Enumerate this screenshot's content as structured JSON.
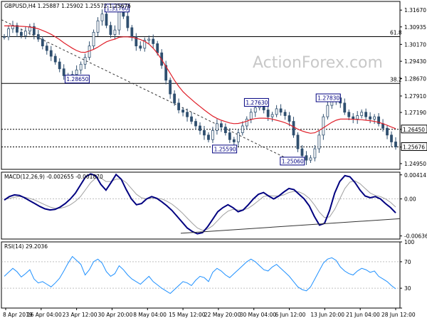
{
  "chart_data": [
    {
      "type": "candlestick",
      "panel": "price",
      "title": "GBPUSD,H4 1.25887 1.25902 1.25572 1.25676",
      "watermark": "ActionForex.com",
      "ylim": [
        1.247,
        1.3205
      ],
      "yticks": [
        "1.31670",
        "1.30935",
        "1.30170",
        "1.29430",
        "1.28670",
        "1.27910",
        "1.27190",
        "1.26450",
        "1.25676",
        "1.24950"
      ],
      "ytick_values": [
        1.3167,
        1.30935,
        1.3017,
        1.2943,
        1.2867,
        1.2791,
        1.2719,
        1.2645,
        1.25676,
        1.2495
      ],
      "hlines": [
        {
          "value": 1.3051,
          "label": "61.8",
          "color": "#000000",
          "style": "solid"
        },
        {
          "value": 1.2846,
          "label": "38.2",
          "color": "#000000",
          "style": "solid"
        },
        {
          "value": 1.2645,
          "label": "1.26450",
          "color": "#000000",
          "style": "dotted"
        },
        {
          "value": 1.2568,
          "label": "1.25676",
          "color": "#000000",
          "style": "dotted"
        }
      ],
      "annotations": [
        {
          "text": "1.31760",
          "x": 0.29,
          "y": 1.3176
        },
        {
          "text": "1.28650",
          "x": 0.19,
          "y": 1.2865
        },
        {
          "text": "1.27630",
          "x": 0.64,
          "y": 1.2763
        },
        {
          "text": "1.27830",
          "x": 0.82,
          "y": 1.2783
        },
        {
          "text": "1.25590",
          "x": 0.56,
          "y": 1.2559
        },
        {
          "text": "1.25060",
          "x": 0.73,
          "y": 1.2506
        }
      ],
      "series": [
        {
          "name": "Close",
          "values": [
            1.305,
            1.3085,
            1.31,
            1.307,
            1.3055,
            1.3075,
            1.3095,
            1.306,
            1.304,
            1.301,
            1.299,
            1.2965,
            1.294,
            1.291,
            1.288,
            1.287,
            1.2885,
            1.2905,
            1.293,
            1.296,
            1.301,
            1.307,
            1.312,
            1.315,
            1.31,
            1.306,
            1.308,
            1.3176,
            1.314,
            1.309,
            1.305,
            1.301,
            1.3,
            1.3035,
            1.304,
            1.302,
            1.298,
            1.2925,
            1.286,
            1.28,
            1.276,
            1.273,
            1.272,
            1.27,
            1.268,
            1.266,
            1.264,
            1.262,
            1.26,
            1.264,
            1.267,
            1.2655,
            1.263,
            1.26,
            1.259,
            1.263,
            1.266,
            1.269,
            1.272,
            1.274,
            1.275,
            1.273,
            1.27,
            1.271,
            1.2735,
            1.272,
            1.2705,
            1.268,
            1.262,
            1.256,
            1.253,
            1.251,
            1.252,
            1.256,
            1.262,
            1.27,
            1.275,
            1.277,
            1.2783,
            1.276,
            1.272,
            1.27,
            1.269,
            1.2705,
            1.272,
            1.27,
            1.269,
            1.27,
            1.267,
            1.265,
            1.262,
            1.259,
            1.2568
          ]
        },
        {
          "name": "MA",
          "values": [
            1.3098,
            1.3098,
            1.3098,
            1.3097,
            1.3096,
            1.3095,
            1.3093,
            1.309,
            1.3085,
            1.3078,
            1.307,
            1.3061,
            1.305,
            1.3038,
            1.3024,
            1.3012,
            1.3,
            1.299,
            1.2983,
            1.2982,
            1.2988,
            1.2995,
            1.3005,
            1.3017,
            1.3028,
            1.3035,
            1.304,
            1.3048,
            1.305,
            1.305,
            1.3048,
            1.3044,
            1.3038,
            1.303,
            1.3018,
            1.3,
            1.2978,
            1.295,
            1.292,
            1.289,
            1.286,
            1.2833,
            1.281,
            1.2792,
            1.2776,
            1.276,
            1.2745,
            1.273,
            1.2716,
            1.2703,
            1.2693,
            1.2685,
            1.2679,
            1.2673,
            1.267,
            1.2671,
            1.2675,
            1.2681,
            1.2688,
            1.2692,
            1.2694,
            1.2694,
            1.2693,
            1.269,
            1.2685,
            1.268,
            1.2674,
            1.2666,
            1.2656,
            1.2646,
            1.2638,
            1.2632,
            1.2628,
            1.263,
            1.264,
            1.2652,
            1.2664,
            1.2676,
            1.2685,
            1.269,
            1.269,
            1.269,
            1.2689,
            1.2688,
            1.2687,
            1.2685,
            1.2683,
            1.268,
            1.2676,
            1.267,
            1.2663,
            1.2655,
            1.2648
          ]
        }
      ],
      "trendline": {
        "from": {
          "x": 0.0,
          "y": 1.3125
        },
        "to": {
          "x": 0.73,
          "y": 1.2506
        }
      }
    },
    {
      "type": "line",
      "panel": "macd",
      "title": "MACD(12,26,9) -0.002655 -0.001870",
      "ylim": [
        -0.0069,
        0.0046
      ],
      "yticks": [
        "0.004141",
        "0.00",
        "-0.006365"
      ],
      "ytick_values": [
        0.004141,
        0.0,
        -0.006365
      ],
      "series": [
        {
          "name": "MACD",
          "values": [
            -0.0002,
            0.0004,
            0.0007,
            0.0006,
            0.0002,
            -0.0003,
            -0.0008,
            -0.0013,
            -0.0017,
            -0.0019,
            -0.0018,
            -0.0014,
            -0.0008,
            0.0,
            0.001,
            0.0024,
            0.0038,
            0.0043,
            0.004,
            0.0025,
            0.0015,
            0.0028,
            0.0042,
            0.0034,
            0.0016,
            0.0,
            -0.001,
            -0.0008,
            0.0,
            0.0004,
            0.0001,
            -0.0005,
            -0.0012,
            -0.002,
            -0.003,
            -0.004,
            -0.005,
            -0.0056,
            -0.006,
            -0.0058,
            -0.0048,
            -0.0035,
            -0.0022,
            -0.0015,
            -0.001,
            -0.0015,
            -0.0022,
            -0.0019,
            -0.001,
            0.0,
            0.0008,
            0.0011,
            0.0005,
            0.0,
            0.0005,
            0.0012,
            0.0018,
            0.0016,
            0.0008,
            0.0,
            -0.0012,
            -0.003,
            -0.0045,
            -0.0042,
            -0.002,
            0.001,
            0.003,
            0.004,
            0.0038,
            0.0028,
            0.0015,
            0.0005,
            0.0002,
            0.0004,
            0.0,
            -0.0008,
            -0.0015,
            -0.0024
          ]
        },
        {
          "name": "Signal",
          "values": [
            0.0,
            0.0001,
            0.0003,
            0.0004,
            0.0003,
            0.0001,
            -0.0002,
            -0.0006,
            -0.001,
            -0.0014,
            -0.0016,
            -0.0016,
            -0.0014,
            -0.001,
            -0.0004,
            0.0004,
            0.0016,
            0.0028,
            0.0036,
            0.0036,
            0.003,
            0.003,
            0.0034,
            0.0034,
            0.0028,
            0.0018,
            0.0008,
            0.0002,
            0.0,
            0.0001,
            0.0001,
            0.0,
            -0.0004,
            -0.0009,
            -0.0016,
            -0.0024,
            -0.0033,
            -0.0042,
            -0.005,
            -0.0054,
            -0.0052,
            -0.0046,
            -0.0037,
            -0.0028,
            -0.0021,
            -0.0018,
            -0.0019,
            -0.0019,
            -0.0016,
            -0.001,
            -0.0003,
            0.0004,
            0.0006,
            0.0005,
            0.0005,
            0.0007,
            0.0011,
            0.0013,
            0.0012,
            0.0008,
            0.0001,
            -0.001,
            -0.0023,
            -0.0032,
            -0.0031,
            -0.0018,
            0.0,
            0.0018,
            0.0029,
            0.0031,
            0.0026,
            0.0018,
            0.001,
            0.0006,
            0.0004,
            0.0,
            -0.0006,
            -0.0014
          ]
        }
      ],
      "trendline": {
        "from": {
          "x": 0.45,
          "y": -0.0059
        },
        "to": {
          "x": 1.0,
          "y": -0.0034
        }
      }
    },
    {
      "type": "line",
      "panel": "rsi",
      "title": "RSI(14) 29.2036",
      "ylim": [
        0,
        100
      ],
      "yticks": [
        "100",
        "70",
        "30",
        "0"
      ],
      "ytick_values": [
        100,
        70,
        30,
        0
      ],
      "series": [
        {
          "name": "RSI",
          "values": [
            48,
            54,
            60,
            55,
            47,
            52,
            58,
            44,
            38,
            40,
            36,
            32,
            38,
            45,
            56,
            68,
            78,
            72,
            66,
            50,
            58,
            70,
            74,
            68,
            55,
            48,
            52,
            64,
            58,
            50,
            44,
            40,
            36,
            42,
            48,
            40,
            35,
            30,
            26,
            22,
            28,
            34,
            40,
            38,
            34,
            42,
            48,
            46,
            40,
            54,
            60,
            56,
            50,
            46,
            52,
            58,
            64,
            70,
            74,
            70,
            64,
            58,
            56,
            62,
            66,
            60,
            54,
            48,
            40,
            32,
            28,
            26,
            32,
            44,
            56,
            68,
            74,
            76,
            72,
            62,
            56,
            52,
            50,
            56,
            60,
            58,
            54,
            56,
            48,
            44,
            40,
            34,
            29
          ]
        }
      ]
    }
  ],
  "x_axis": {
    "labels": [
      "8 Apr 2019",
      "16 Apr 04:00",
      "23 Apr 12:00",
      "30 Apr 20:00",
      "8 May 04:00",
      "15 May 12:00",
      "22 May 20:00",
      "30 May 04:00",
      "6 Jun 12:00",
      "13 Jun 20:00",
      "21 Jun 04:00",
      "28 Jun 12:00"
    ]
  },
  "colors": {
    "candle": "#2f4f6f",
    "ma": "#e0202a",
    "macd": "#000080",
    "signal": "#a0a0a0",
    "rsi": "#1e90ff",
    "label": "#000080",
    "frame": "#000000"
  }
}
